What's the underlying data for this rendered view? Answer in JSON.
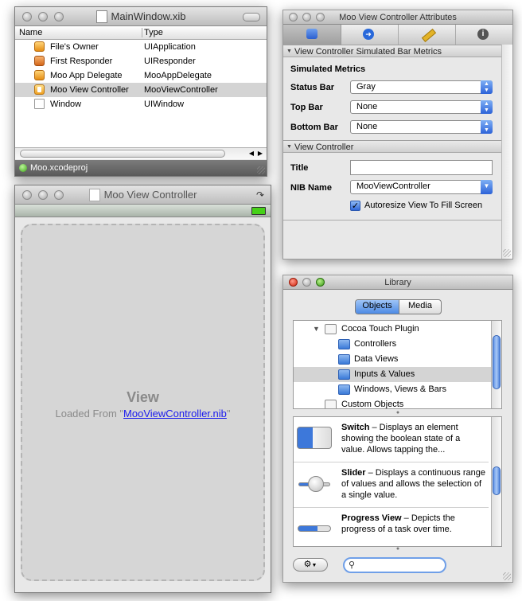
{
  "main_window": {
    "title": "MainWindow.xib",
    "col_name": "Name",
    "col_type": "Type",
    "rows": [
      {
        "name": "File's Owner",
        "type": "UIApplication",
        "icon": "cube-icon"
      },
      {
        "name": "First Responder",
        "type": "UIResponder",
        "icon": "cube-icon"
      },
      {
        "name": "Moo App Delegate",
        "type": "MooAppDelegate",
        "icon": "cube-icon"
      },
      {
        "name": "Moo View Controller",
        "type": "MooViewController",
        "icon": "view-controller-icon"
      },
      {
        "name": "Window",
        "type": "UIWindow",
        "icon": "window-icon"
      }
    ],
    "project": "Moo.xcodeproj"
  },
  "vc_window": {
    "title": "Moo View Controller",
    "view_title": "View",
    "loaded_from_prefix": "Loaded From \"",
    "nib_link": "MooViewController.nib",
    "loaded_from_suffix": "\""
  },
  "attributes": {
    "title": "Moo View Controller Attributes",
    "section1": "View Controller Simulated Bar Metrics",
    "simulated_metrics": "Simulated Metrics",
    "status_bar_label": "Status Bar",
    "status_bar_value": "Gray",
    "top_bar_label": "Top Bar",
    "top_bar_value": "None",
    "bottom_bar_label": "Bottom Bar",
    "bottom_bar_value": "None",
    "section2": "View Controller",
    "title_label": "Title",
    "title_value": "",
    "nib_label": "NIB Name",
    "nib_value": "MooViewController",
    "autoresize_label": "Autoresize View To Fill Screen",
    "autoresize_checked": true
  },
  "library": {
    "title": "Library",
    "seg_objects": "Objects",
    "seg_media": "Media",
    "tree": [
      {
        "label": "Cocoa Touch Plugin",
        "indent": 0,
        "folder": "white",
        "disclosure": true
      },
      {
        "label": "Controllers",
        "indent": 1,
        "folder": "blue"
      },
      {
        "label": "Data Views",
        "indent": 1,
        "folder": "blue"
      },
      {
        "label": "Inputs & Values",
        "indent": 1,
        "folder": "blue",
        "selected": true
      },
      {
        "label": "Windows, Views & Bars",
        "indent": 1,
        "folder": "blue"
      },
      {
        "label": "Custom Objects",
        "indent": 0,
        "folder": "white"
      }
    ],
    "items": [
      {
        "name": "Switch",
        "desc": " – Displays an element showing the boolean state of a value. Allows tapping the..."
      },
      {
        "name": "Slider",
        "desc": " – Displays a continuous range of values and allows the selection of a single value."
      },
      {
        "name": "Progress View",
        "desc": " – Depicts the progress of a task over time."
      }
    ],
    "search_value": ""
  },
  "colors": {
    "selection": "#d4d4d4",
    "link": "#1a1aee",
    "accent_blue": "#2c62d8"
  }
}
